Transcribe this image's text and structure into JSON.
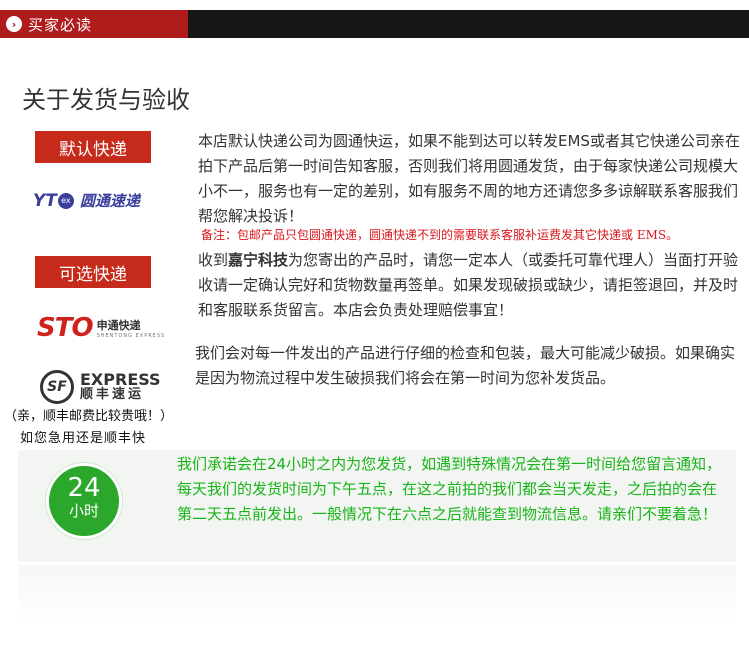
{
  "header": {
    "tab_title": "买家必读",
    "bullet": "›"
  },
  "section_title": "关于发货与验收",
  "buttons": {
    "default_express": "默认快递",
    "optional_express": "可选快递"
  },
  "logos": {
    "yto_mark": "YT",
    "yto_circle": "ex",
    "yto_name": "圆通速递",
    "sto_mark": "STO",
    "sto_cn": "申通快递",
    "sto_en": "SHENTONG EXPRESS",
    "sf_badge": "SF",
    "sf_en": "EXPRESS",
    "sf_cn": "顺丰速运"
  },
  "notes": {
    "sf_expensive": "（亲，顺丰邮费比较贵哦！）",
    "sf_urgent": "如您急用还是顺丰快"
  },
  "paragraphs": {
    "default_policy": "本店默认快递公司为圆通快运，如果不能到达可以转发EMS或者其它快递公司亲在拍下产品后第一时间告知客服，否则我们将用圆通发货，由于每家快递公司规模大小不一，服务也有一定的差别，如有服务不周的地方还请您多多谅解联系客服我们帮您解决投诉！",
    "remark": "备注：包邮产品只包圆通快递，圆通快递不到的需要联系客服补运费发其它快递或 EMS。",
    "receive_pre": "收到",
    "receive_brand": "嘉宁科技",
    "receive_post": "为您寄出的产品时，请您一定本人（或委托可靠代理人）当面打开验收请一定确认完好和货物数量再签单。如果发现破损或缺少，请拒签退回，并及时和客服联系货留言。本店会负责处理赔偿事宜！",
    "inspection": "我们会对每一件发出的产品进行仔细的检查和包装，最大可能减少破损。如果确实是因为物流过程中发生破损我们将会在第一时间为您补发货品。",
    "promise": "我们承诺会在24小时之内为您发货，如遇到特殊情况会在第一时间给您留言通知，每天我们的发货时间为下午五点，在这之前拍的我们都会当天发走，之后拍的会在第二天五点前发出。一般情况下在六点之后就能查到物流信息。请亲们不要着急！"
  },
  "badge24": {
    "number": "24",
    "unit": "小时"
  },
  "colors": {
    "header_red": "#b01c1c",
    "button_red": "#c62a1a",
    "promise_green": "#19b419",
    "remark_red": "#d9161b"
  }
}
